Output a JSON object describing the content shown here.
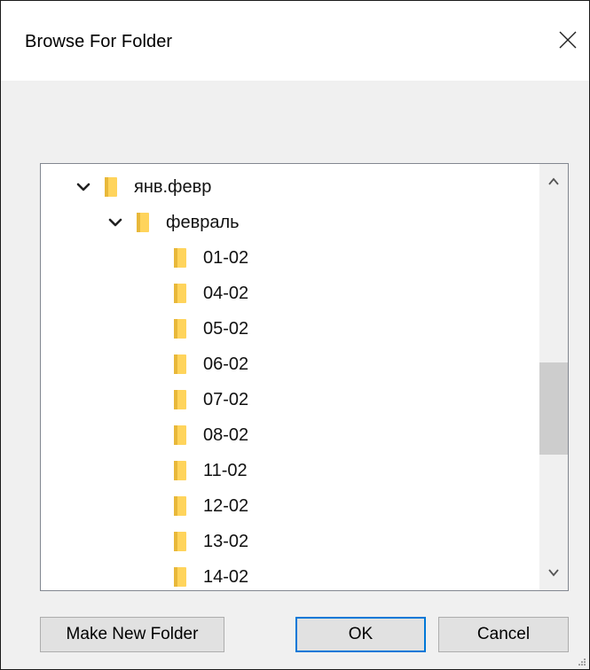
{
  "window": {
    "title": "Browse For Folder"
  },
  "tree": {
    "items": [
      {
        "label": "янв.февр",
        "level": 0,
        "expanded": true
      },
      {
        "label": "февраль",
        "level": 1,
        "expanded": true
      },
      {
        "label": "01-02",
        "level": 2
      },
      {
        "label": "04-02",
        "level": 2
      },
      {
        "label": "05-02",
        "level": 2
      },
      {
        "label": "06-02",
        "level": 2
      },
      {
        "label": "07-02",
        "level": 2
      },
      {
        "label": "08-02",
        "level": 2
      },
      {
        "label": "11-02",
        "level": 2
      },
      {
        "label": "12-02",
        "level": 2
      },
      {
        "label": "13-02",
        "level": 2
      },
      {
        "label": "14-02",
        "level": 2
      }
    ]
  },
  "buttons": {
    "make_new_folder": "Make New Folder",
    "ok": "OK",
    "cancel": "Cancel"
  },
  "colors": {
    "folder": "#ffd45c",
    "focus_border": "#0078d7"
  }
}
